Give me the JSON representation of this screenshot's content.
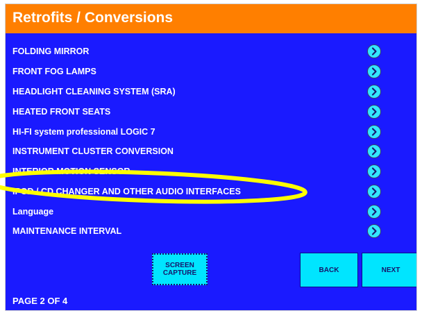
{
  "header": {
    "title": "Retrofits / Conversions"
  },
  "menu": {
    "items": [
      {
        "label": "FOLDING MIRROR"
      },
      {
        "label": "FRONT FOG LAMPS"
      },
      {
        "label": "HEADLIGHT CLEANING SYSTEM (SRA)"
      },
      {
        "label": "HEATED FRONT SEATS"
      },
      {
        "label": "HI-FI system professional LOGIC 7"
      },
      {
        "label": "INSTRUMENT CLUSTER CONVERSION"
      },
      {
        "label": "INTERIOR MOTION SENSOR"
      },
      {
        "label": "IPOD / CD CHANGER AND OTHER AUDIO INTERFACES"
      },
      {
        "label": "Language"
      },
      {
        "label": "MAINTENANCE INTERVAL"
      }
    ],
    "arrow_icon": "chevron-right-circle-icon"
  },
  "buttons": {
    "screen_capture_line1": "SCREEN",
    "screen_capture_line2": "CAPTURE",
    "back": "BACK",
    "next": "NEXT"
  },
  "footer": {
    "page_indicator": "PAGE 2 OF 4"
  },
  "colors": {
    "background": "#1a1aff",
    "title_bar": "#ff7f00",
    "button": "#00e5ff",
    "highlight": "#ffff00"
  }
}
